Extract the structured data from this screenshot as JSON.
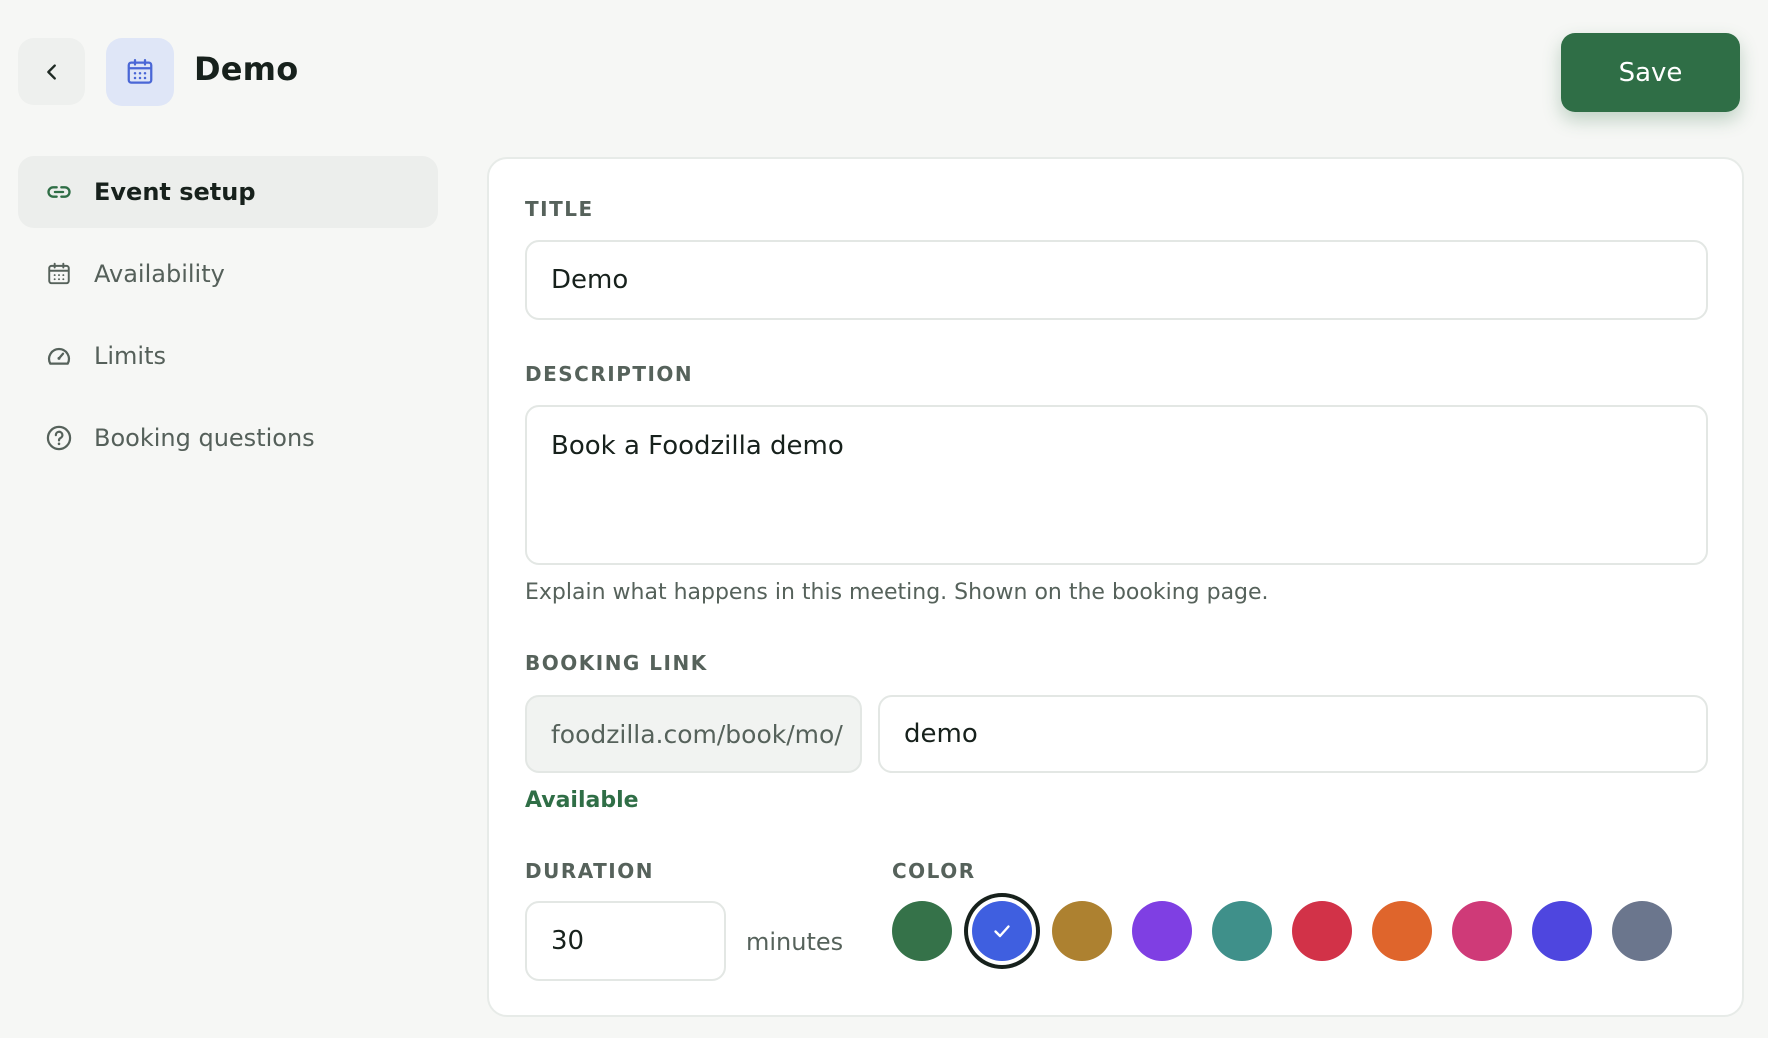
{
  "header": {
    "title": "Demo",
    "save_label": "Save"
  },
  "icons": {
    "back": "chevron-left-icon",
    "event": "calendar-icon"
  },
  "sidebar": {
    "items": [
      {
        "label": "Event setup",
        "icon": "link-icon",
        "active": true
      },
      {
        "label": "Availability",
        "icon": "calendar-icon",
        "active": false
      },
      {
        "label": "Limits",
        "icon": "speedometer-icon",
        "active": false
      },
      {
        "label": "Booking questions",
        "icon": "question-circle-icon",
        "active": false
      }
    ]
  },
  "form": {
    "title": {
      "label": "TITLE",
      "value": "Demo"
    },
    "description": {
      "label": "DESCRIPTION",
      "value": "Book a Foodzilla demo",
      "hint": "Explain what happens in this meeting. Shown on the booking page."
    },
    "booking_link": {
      "label": "BOOKING LINK",
      "prefix": "foodzilla.com/book/mo/",
      "slug": "demo",
      "status": "Available"
    },
    "duration": {
      "label": "DURATION",
      "value": "30",
      "unit": "minutes"
    },
    "color": {
      "label": "COLOR",
      "selected_index": 1,
      "options": [
        "#357249",
        "#3f5fe0",
        "#ad8130",
        "#7f3fe3",
        "#3f908a",
        "#d23248",
        "#df652c",
        "#cf3a78",
        "#4e46df",
        "#6b768d"
      ]
    }
  },
  "colors": {
    "accent": "#2f6e46",
    "background": "#f6f7f5",
    "event_icon": "#4a67d6"
  }
}
